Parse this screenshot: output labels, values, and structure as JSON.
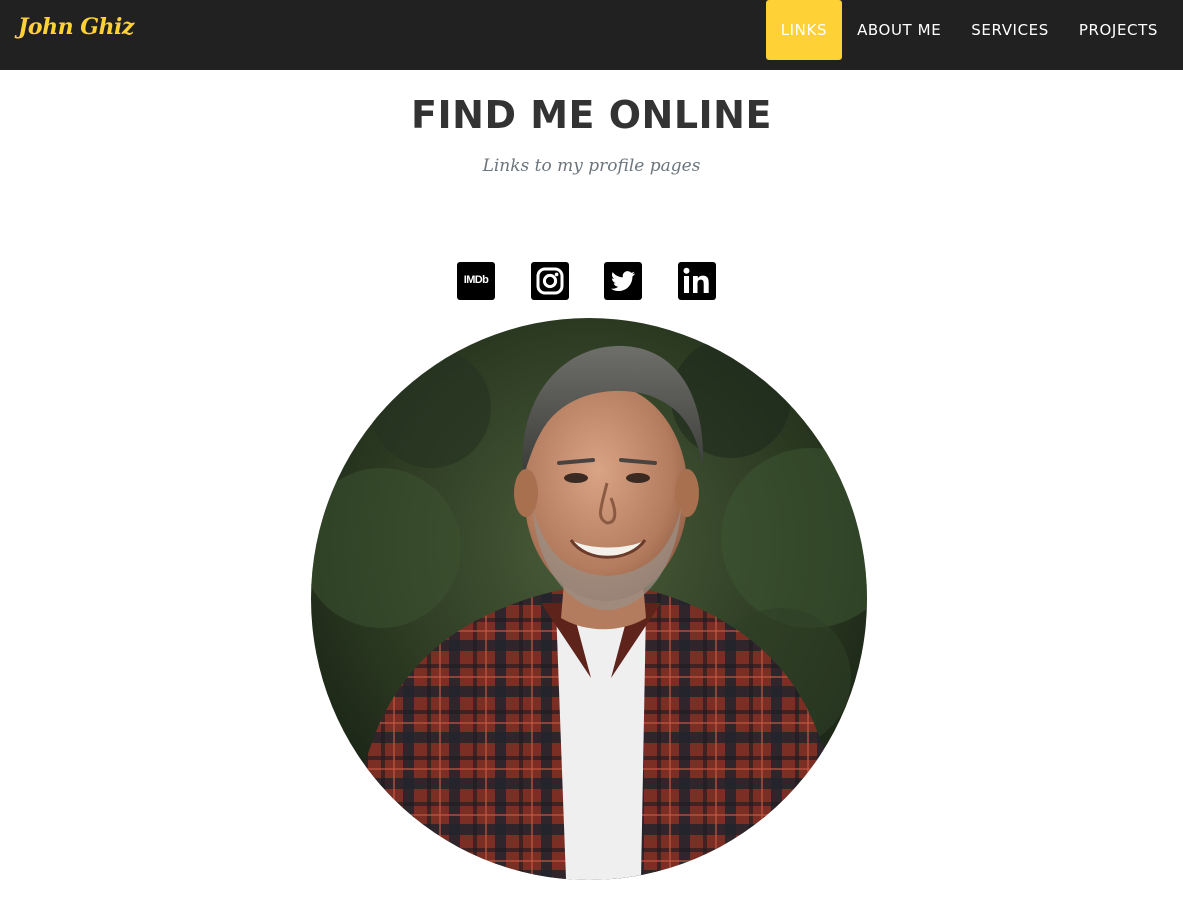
{
  "brand": {
    "name": "John Ghiz",
    "color": "#fed136"
  },
  "nav": {
    "items": [
      {
        "label": "LINKS",
        "active": true
      },
      {
        "label": "ABOUT ME",
        "active": false
      },
      {
        "label": "SERVICES",
        "active": false
      },
      {
        "label": "PROJECTS",
        "active": false
      }
    ],
    "background": "#212121",
    "active_color": "#fed136"
  },
  "hero": {
    "title": "FIND ME ONLINE",
    "subtitle": "Links to my profile pages"
  },
  "social_links": [
    {
      "icon": "imdb-icon",
      "text": "IMDb"
    },
    {
      "icon": "instagram-icon"
    },
    {
      "icon": "twitter-icon"
    },
    {
      "icon": "linkedin-icon"
    }
  ],
  "portrait": {
    "subject": "portrait-photo"
  }
}
